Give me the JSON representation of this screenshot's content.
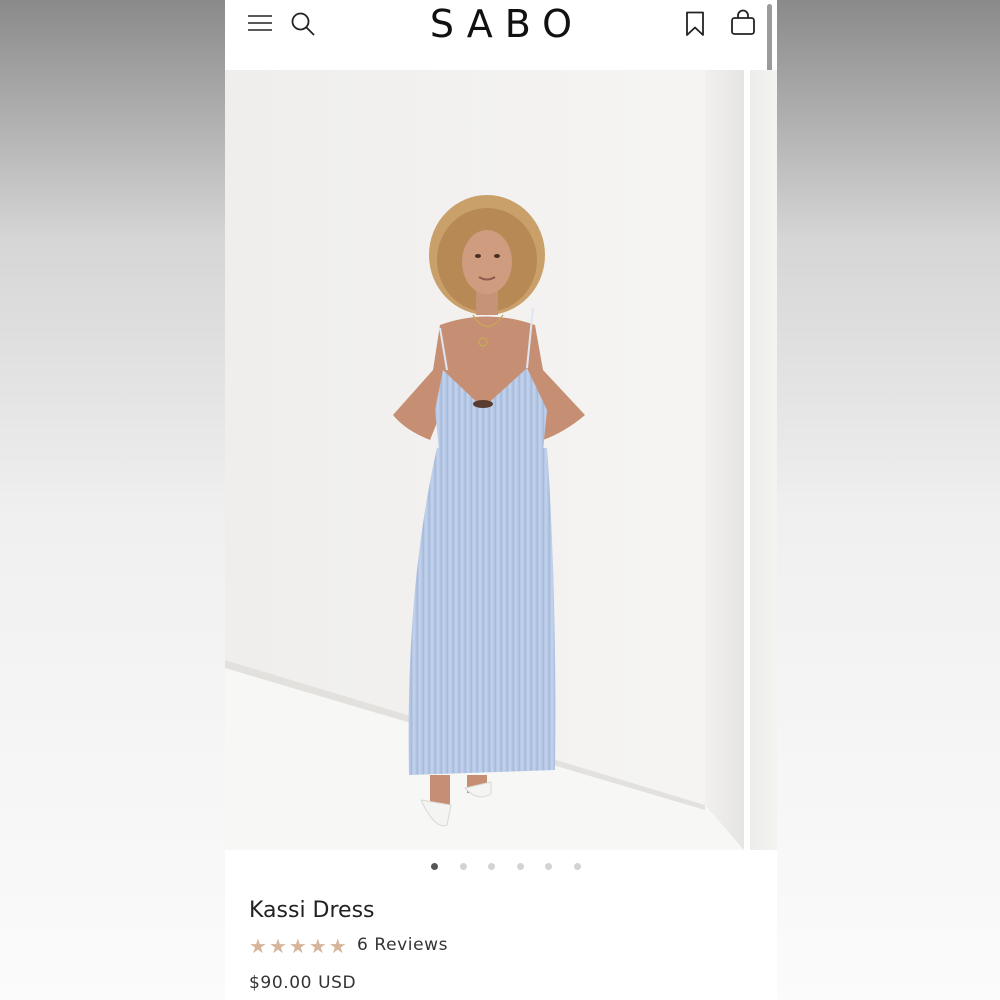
{
  "brand": {
    "logo": "SABO"
  },
  "header": {
    "icons": {
      "menu": "hamburger-menu-icon",
      "search": "search-icon",
      "wishlist": "bookmark-icon",
      "cart": "shopping-bag-icon"
    }
  },
  "gallery": {
    "slide_count": 6,
    "active_index": 0
  },
  "product": {
    "name": "Kassi Dress",
    "rating": 5,
    "max_rating": 5,
    "reviews_label": "6 Reviews",
    "price": "$90.00 USD"
  },
  "colors": {
    "star": "#d6b59a",
    "accent_text": "#222222",
    "dress_blue": "#b7c9e6"
  }
}
